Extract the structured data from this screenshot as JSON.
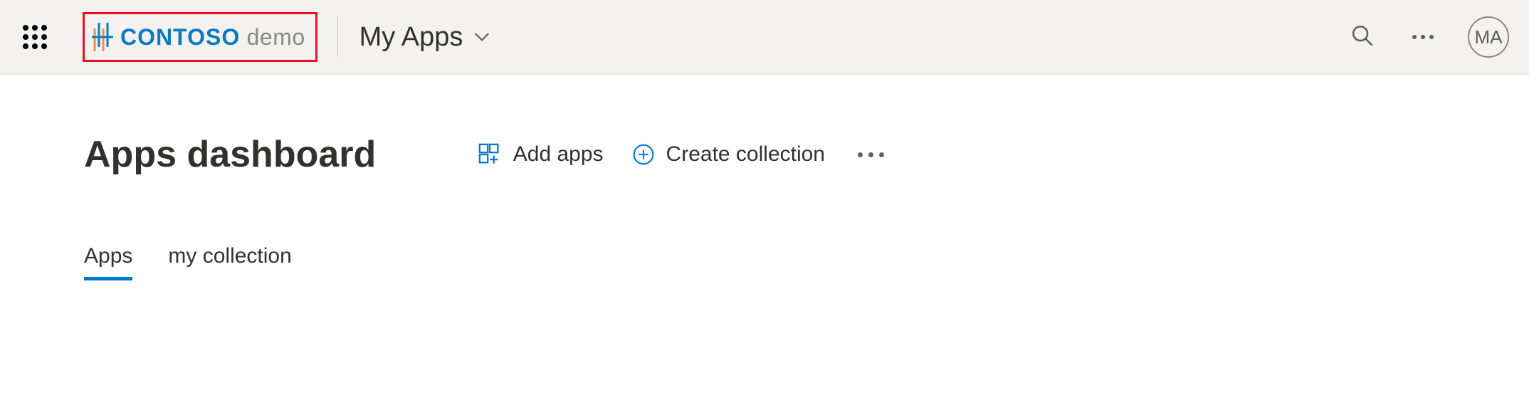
{
  "header": {
    "brand_strong": "CONTOSO",
    "brand_light": "demo",
    "app_dropdown_label": "My Apps"
  },
  "avatar": {
    "initials": "MA"
  },
  "page": {
    "title": "Apps dashboard",
    "actions": {
      "add_apps": "Add apps",
      "create_collection": "Create collection"
    },
    "tabs": [
      {
        "label": "Apps",
        "active": true
      },
      {
        "label": "my collection",
        "active": false
      }
    ]
  }
}
